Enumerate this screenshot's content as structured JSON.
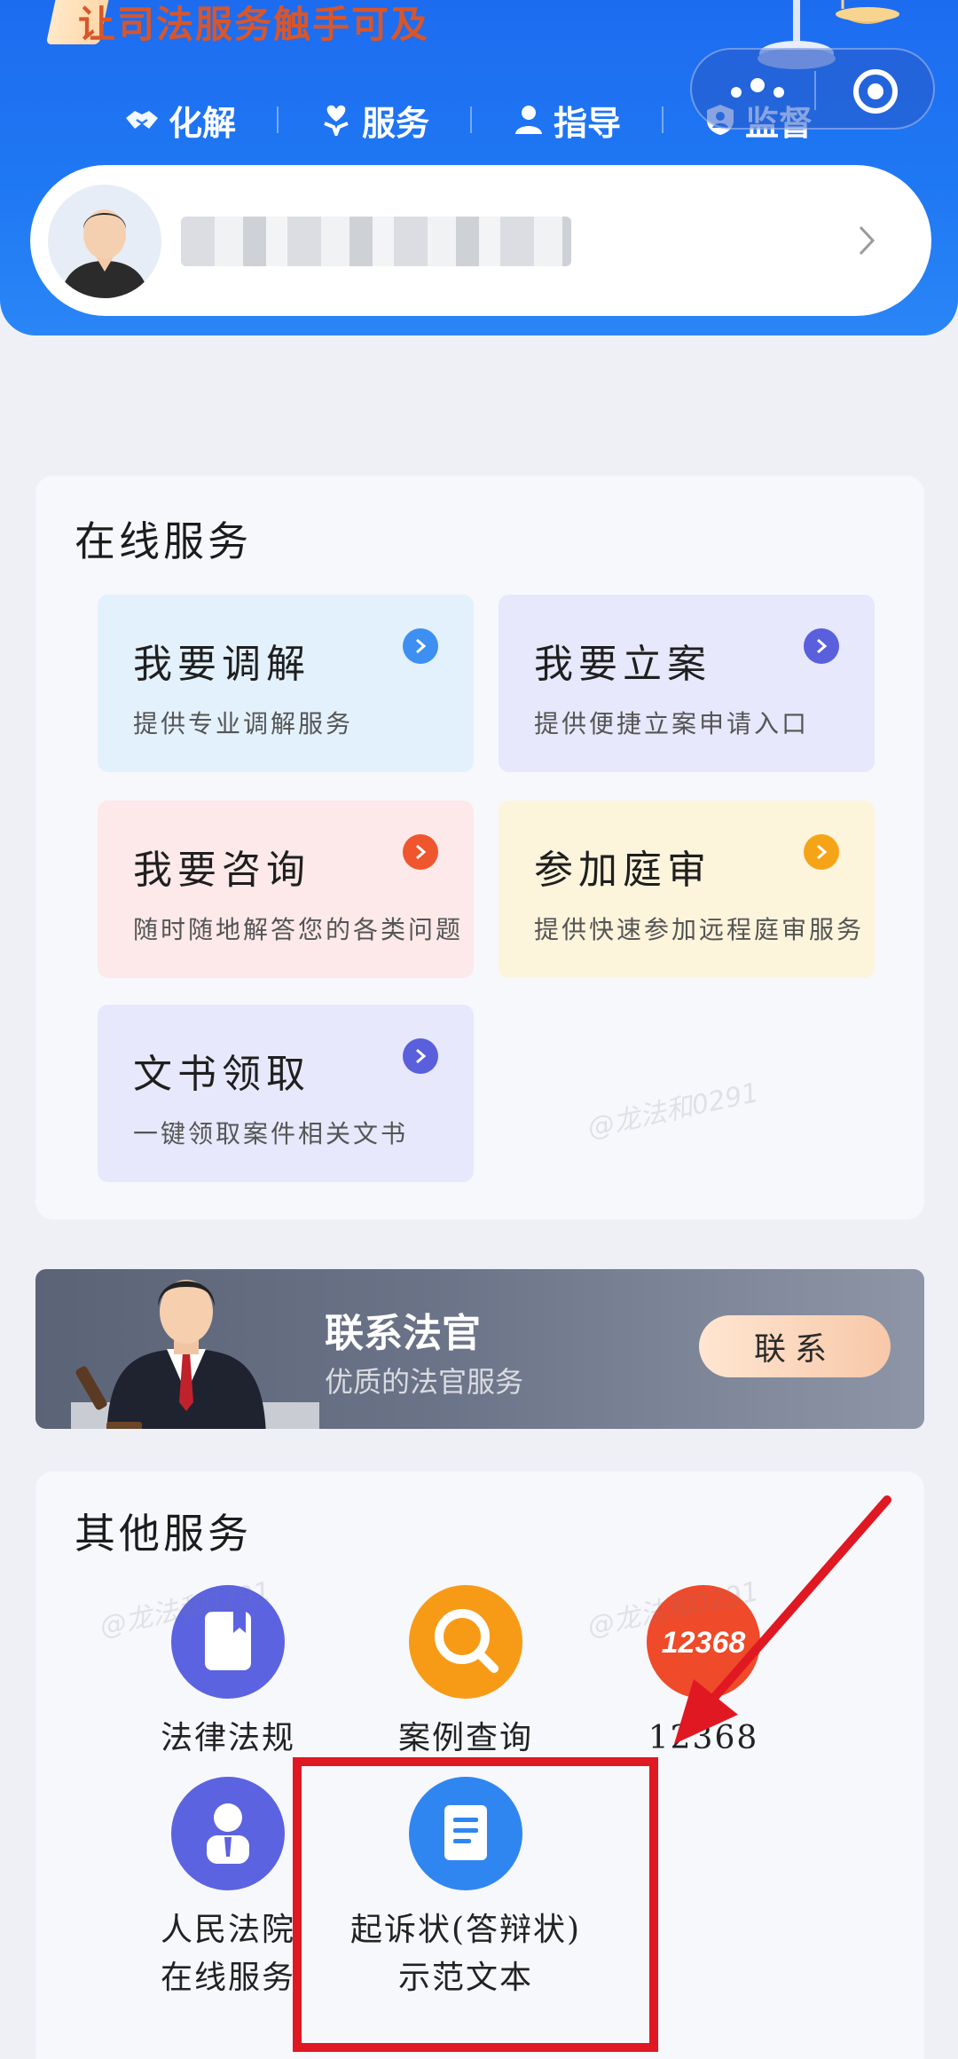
{
  "header": {
    "slogan": "让司法服务触手可及",
    "nav": [
      {
        "label": "化解",
        "icon": "handshake-icon"
      },
      {
        "label": "服务",
        "icon": "heart-hand-icon"
      },
      {
        "label": "指导",
        "icon": "person-guide-icon"
      },
      {
        "label": "监督",
        "icon": "shield-person-icon"
      }
    ]
  },
  "capsule": {
    "more_icon": "more-dots-icon",
    "close_icon": "target-icon"
  },
  "profile": {
    "avatar_icon": "user-avatar-icon",
    "chevron_icon": "chevron-right-icon"
  },
  "online_services": {
    "title": "在线服务",
    "tiles": [
      {
        "title": "我要调解",
        "subtitle": "提供专业调解服务",
        "bg": "#e3f1fd",
        "arrow_color": "#3d8ff2"
      },
      {
        "title": "我要立案",
        "subtitle": "提供便捷立案申请入口",
        "bg": "#e7e8fb",
        "arrow_color": "#5a5fdc"
      },
      {
        "title": "我要咨询",
        "subtitle": "随时随地解答您的各类问题",
        "bg": "#fde9ea",
        "arrow_color": "#f0562e"
      },
      {
        "title": "参加庭审",
        "subtitle": "提供快速参加远程庭审服务",
        "bg": "#fdf4dc",
        "arrow_color": "#f6a417"
      },
      {
        "title": "文书领取",
        "subtitle": "一键领取案件相关文书",
        "bg": "#e7e8fb",
        "arrow_color": "#5a5fdc"
      }
    ]
  },
  "contact_banner": {
    "title": "联系法官",
    "subtitle": "优质的法官服务",
    "button": "联系"
  },
  "other_services": {
    "title": "其他服务",
    "items": [
      {
        "label": "法律法规",
        "icon": "book-icon",
        "color": "#5b63e0"
      },
      {
        "label": "案例查询",
        "icon": "magnifier-icon",
        "color": "#f79b16"
      },
      {
        "label": "12368",
        "icon": "hotline-12368-icon",
        "color": "#ef4a2a"
      },
      {
        "label": "人民法院在线服务",
        "line1": "人民法院",
        "line2": "在线服务",
        "icon": "court-person-icon",
        "color": "#5b63e0"
      },
      {
        "label": "起诉状(答辩状)示范文本",
        "line1": "起诉状(答辩状)",
        "line2": "示范文本",
        "icon": "document-icon",
        "color": "#2f86f0"
      }
    ]
  },
  "watermark": "@龙法和0291"
}
